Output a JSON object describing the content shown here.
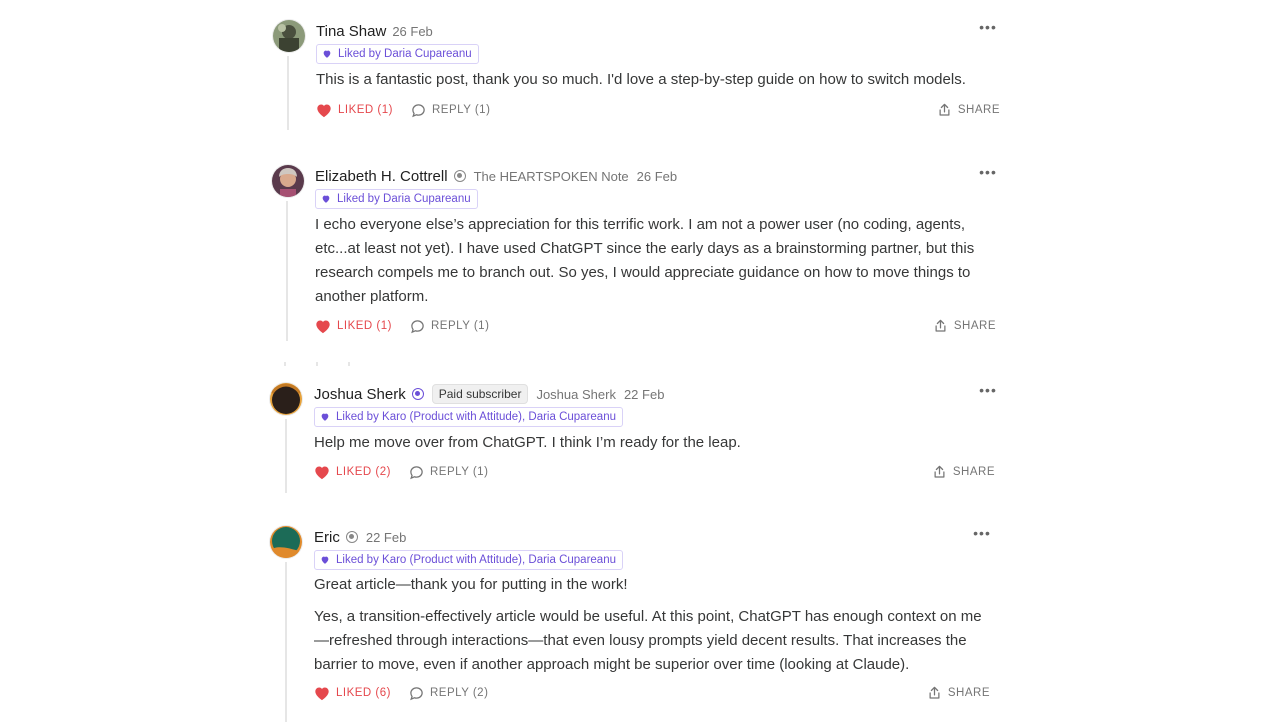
{
  "comments": [
    {
      "author": "Tina Shaw",
      "date": "26 Feb",
      "liked_by": "Liked by Daria Cupareanu",
      "paragraphs": [
        "This is a fantastic post, thank you so much. I'd love a step-by-step guide on how to switch models."
      ],
      "liked_label": "LIKED (1)",
      "reply_label": "REPLY (1)",
      "share_label": "SHARE"
    },
    {
      "author": "Elizabeth H. Cottrell",
      "publication": "The HEARTSPOKEN Note",
      "date": "26 Feb",
      "liked_by": "Liked by Daria Cupareanu",
      "paragraphs": [
        "I echo everyone else’s appreciation for this terrific work. I am not a power user (no coding, agents, etc...at least not yet). I have used ChatGPT since the early days as a brainstorming partner, but this research compels me to branch out. So yes, I would appreciate guidance on how to move things to another platform."
      ],
      "liked_label": "LIKED (1)",
      "reply_label": "REPLY (1)",
      "share_label": "SHARE"
    },
    {
      "author": "Joshua Sherk",
      "paid_badge": "Paid subscriber",
      "publication": "Joshua Sherk",
      "date": "22 Feb",
      "liked_by": "Liked by Karo (Product with Attitude), Daria Cupareanu",
      "paragraphs": [
        "Help me move over from ChatGPT. I think I’m ready for the leap."
      ],
      "liked_label": "LIKED (2)",
      "reply_label": "REPLY (1)",
      "share_label": "SHARE"
    },
    {
      "author": "Eric",
      "date": "22 Feb",
      "liked_by": "Liked by Karo (Product with Attitude), Daria Cupareanu",
      "paragraphs": [
        "Great article—thank you for putting in the work!",
        "Yes, a transition-effectively article would be useful. At this point, ChatGPT has enough context on me—refreshed through interactions—that even lousy prompts yield decent results. That increases the barrier to move, even if another approach might be superior over time (looking at Claude)."
      ],
      "liked_label": "LIKED (6)",
      "reply_label": "REPLY (2)",
      "share_label": "SHARE"
    }
  ],
  "more_icon": "ellipsis-icon",
  "colors": {
    "liked": "#e5484d",
    "liked_by": "#6b4fd8",
    "meta": "#757575"
  }
}
